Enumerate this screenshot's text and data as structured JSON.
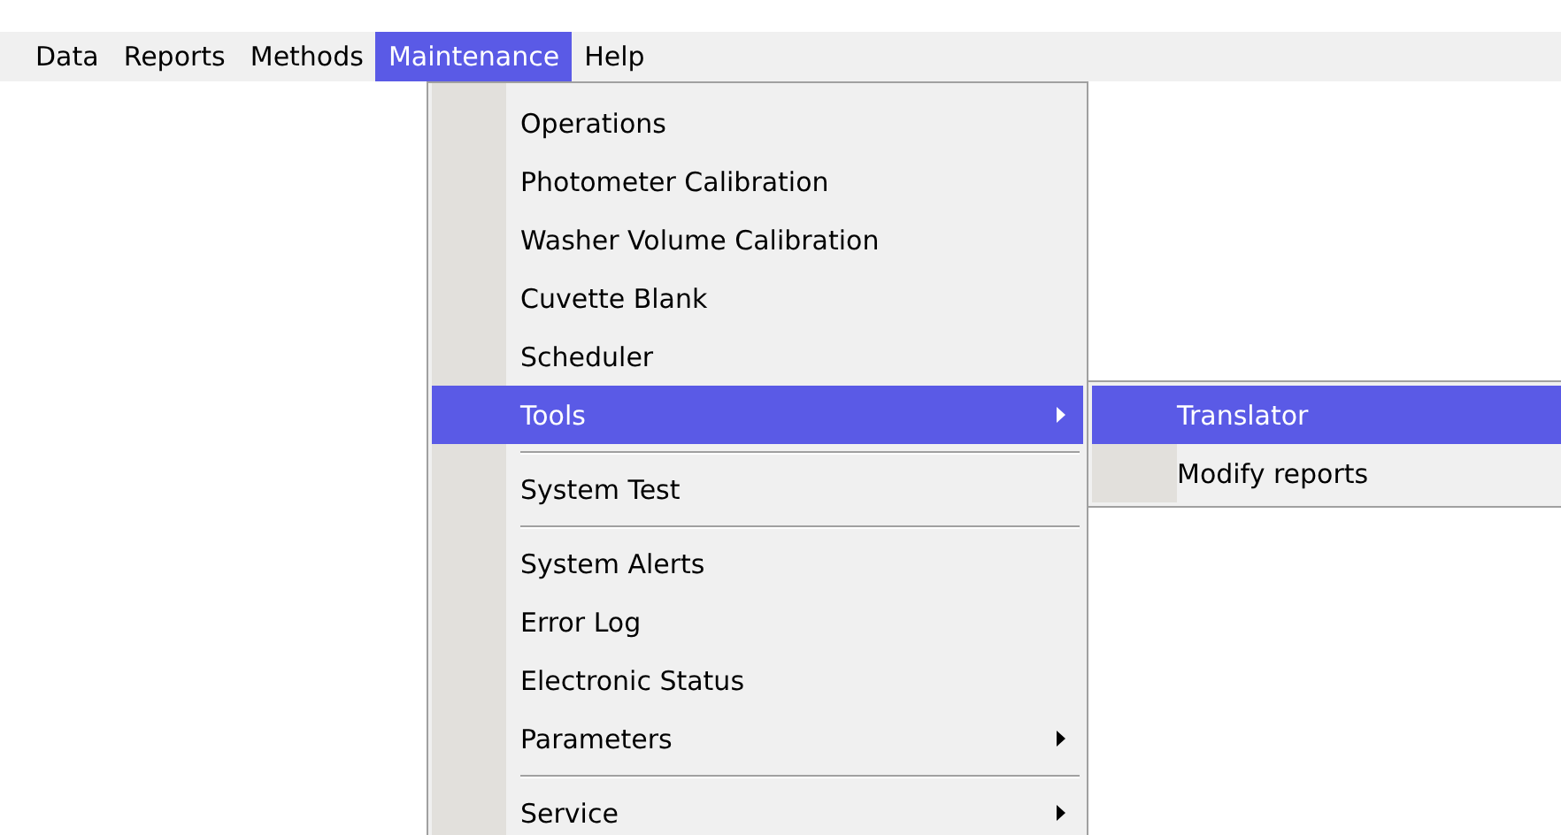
{
  "menubar": [
    {
      "label": "Data",
      "selected": false
    },
    {
      "label": "Reports",
      "selected": false
    },
    {
      "label": "Methods",
      "selected": false
    },
    {
      "label": "Maintenance",
      "selected": true
    },
    {
      "label": "Help",
      "selected": false
    }
  ],
  "menu": [
    {
      "kind": "item",
      "label": "Operations",
      "selected": false,
      "has_submenu": false
    },
    {
      "kind": "item",
      "label": "Photometer Calibration",
      "selected": false,
      "has_submenu": false
    },
    {
      "kind": "item",
      "label": "Washer Volume Calibration",
      "selected": false,
      "has_submenu": false
    },
    {
      "kind": "item",
      "label": "Cuvette Blank",
      "selected": false,
      "has_submenu": false
    },
    {
      "kind": "item",
      "label": "Scheduler",
      "selected": false,
      "has_submenu": false
    },
    {
      "kind": "item",
      "label": "Tools",
      "selected": true,
      "has_submenu": true,
      "children": [
        {
          "label": "Translator",
          "selected": true
        },
        {
          "label": "Modify reports",
          "selected": false
        }
      ]
    },
    {
      "kind": "separator"
    },
    {
      "kind": "item",
      "label": "System Test",
      "selected": false,
      "has_submenu": false
    },
    {
      "kind": "separator"
    },
    {
      "kind": "item",
      "label": "System Alerts",
      "selected": false,
      "has_submenu": false
    },
    {
      "kind": "item",
      "label": "Error Log",
      "selected": false,
      "has_submenu": false
    },
    {
      "kind": "item",
      "label": "Electronic Status",
      "selected": false,
      "has_submenu": false
    },
    {
      "kind": "item",
      "label": "Parameters",
      "selected": false,
      "has_submenu": true
    },
    {
      "kind": "separator"
    },
    {
      "kind": "item",
      "label": "Service",
      "selected": false,
      "has_submenu": true
    }
  ]
}
